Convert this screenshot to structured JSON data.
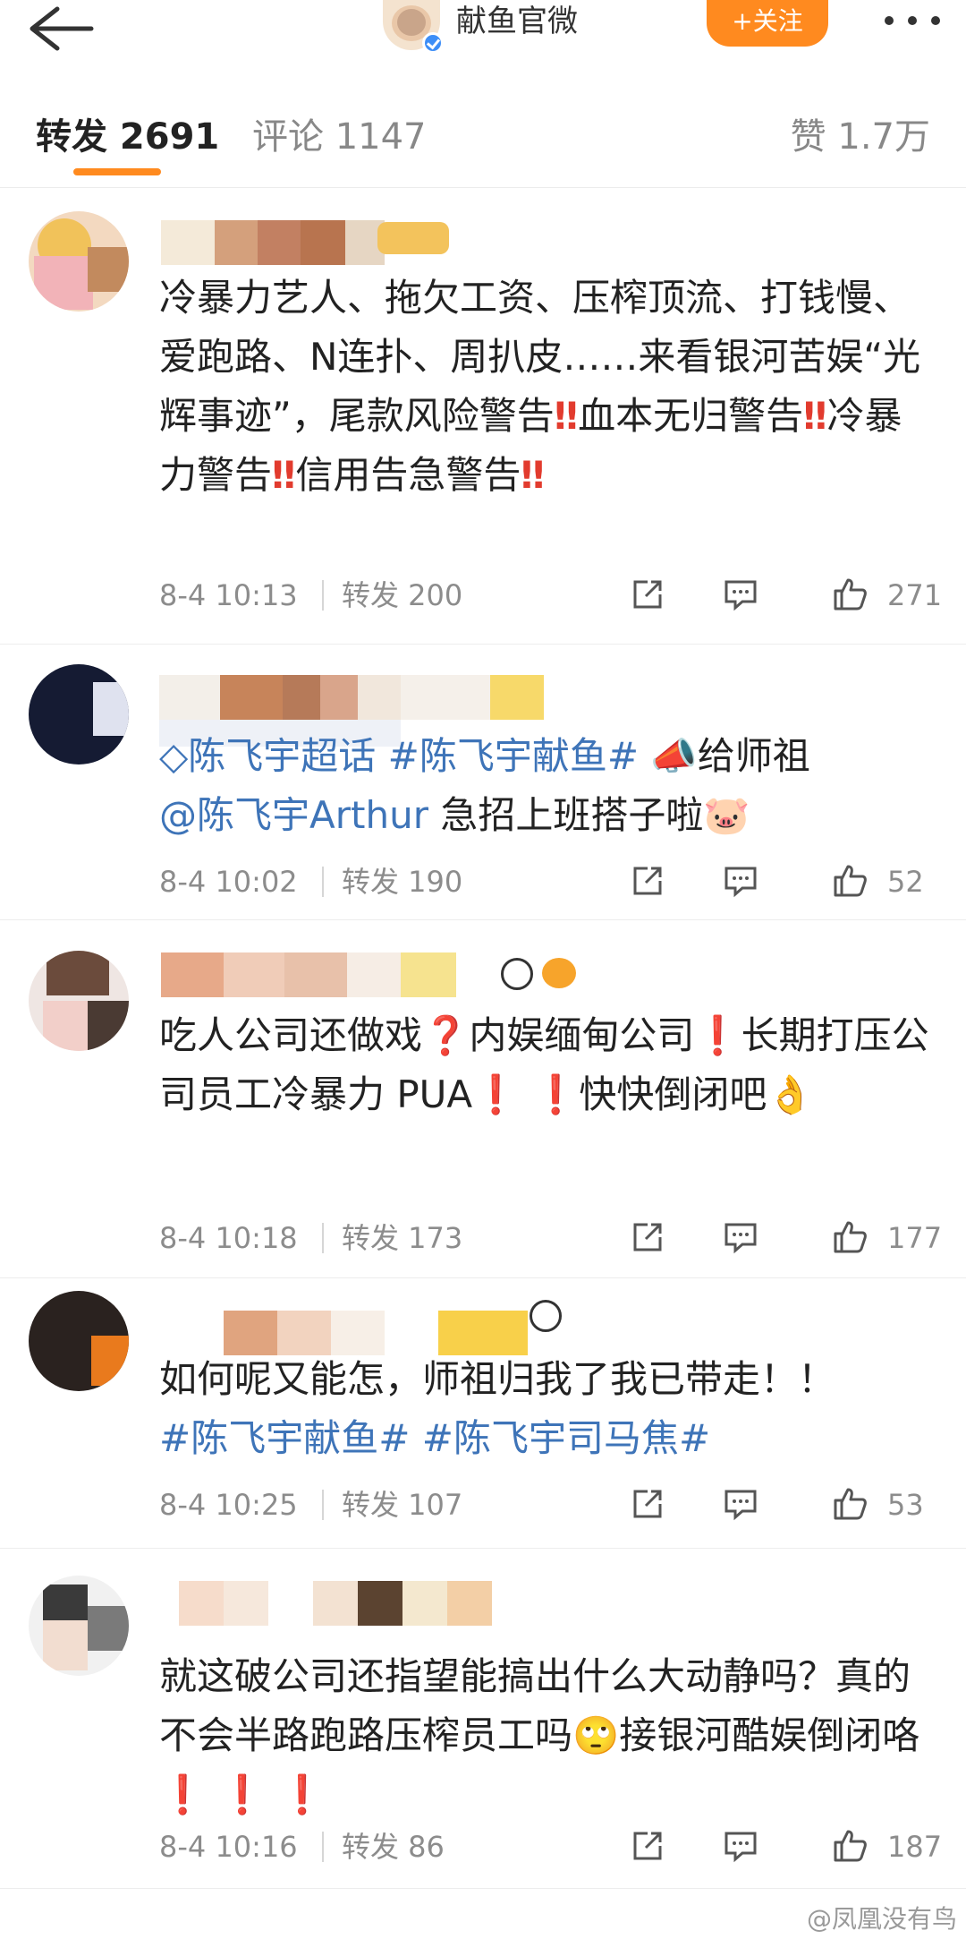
{
  "header": {
    "back_icon": "arrow-left-icon",
    "account_name": "献鱼官微",
    "follow_label": "+关注",
    "more_icon": "more-dots-icon"
  },
  "tabs": {
    "repost": "转发 2691",
    "comments": "评论 1147",
    "likes": "赞 1.7万"
  },
  "comments": [
    {
      "text_parts": [
        "冷暴力艺人、拖欠工资、压榨顶流、打钱慢、爱跑路、N连扑、周扒皮……来看银河苦娱“光辉事迹”，尾款风险警告",
        "‼",
        "血本无归警告",
        "‼",
        "冷暴力警告",
        "‼",
        "信用告急警告",
        "‼"
      ],
      "time": "8-4 10:13",
      "repost": "转发 200",
      "likes": "271"
    },
    {
      "topic1": "◇陈飞宇超话",
      "topic2": "#陈飞宇献鱼#",
      "text1": "📣给师祖",
      "mention": "@陈飞宇Arthur",
      "text2": "急招上班搭子啦🐷",
      "time": "8-4 10:02",
      "repost": "转发 190",
      "likes": "52"
    },
    {
      "text_parts": [
        "吃人公司还做戏",
        "❓",
        "内娱缅甸公司",
        "❗",
        "长期打压公司员工冷暴力 PUA",
        "❗ ❗",
        "快快倒闭吧👌"
      ],
      "time": "8-4 10:18",
      "repost": "转发 173",
      "likes": "177"
    },
    {
      "text": "如何呢又能怎，师祖归我了我已带走！！",
      "topic1": "#陈飞宇献鱼#",
      "topic2": "#陈飞宇司马焦#",
      "time": "8-4 10:25",
      "repost": "转发 107",
      "likes": "53"
    },
    {
      "text1": "就这破公司还指望能搞出什么大动静吗？真的不会半路跑路压榨员工吗",
      "text2": "🙄接银河酷娱倒闭咯",
      "marks": "❗ ❗ ❗",
      "time": "8-4 10:16",
      "repost": "转发 86",
      "likes": "187"
    }
  ],
  "watermark": "@凤凰没有鸟",
  "icons": {
    "share": "share-icon",
    "comment": "comment-icon",
    "like": "thumbs-up-icon"
  },
  "colors": {
    "accent": "#ff8a1f",
    "topic": "#3e74b8",
    "alert": "#e23b2e"
  }
}
